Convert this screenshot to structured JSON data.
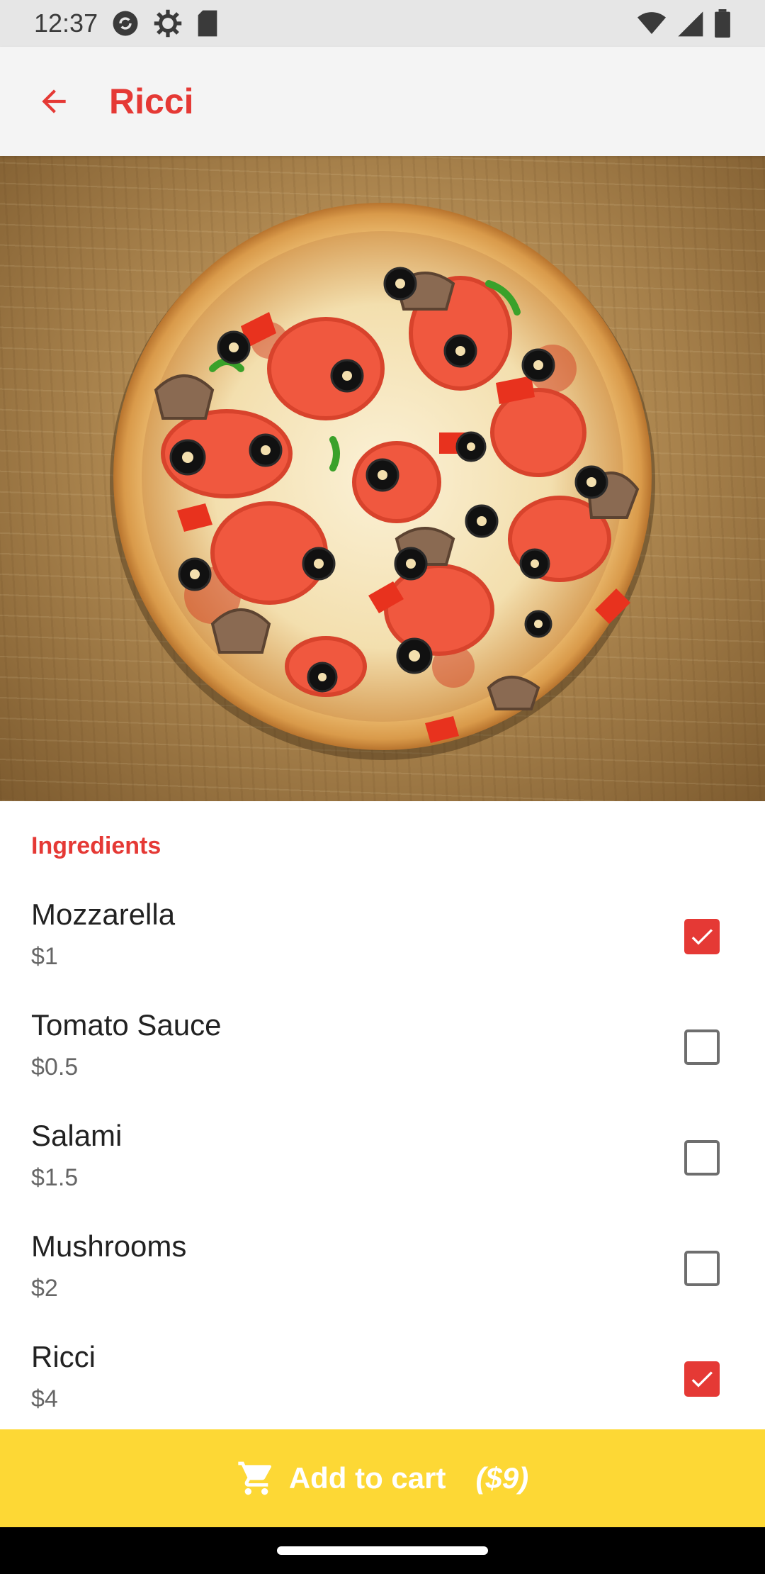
{
  "status_bar": {
    "time": "12:37"
  },
  "app_bar": {
    "title": "Ricci",
    "back_icon": "arrow-back-icon"
  },
  "colors": {
    "accent": "#e53935",
    "cart_bar": "#fdd835",
    "app_bar_bg": "#f4f4f4"
  },
  "ingredients": {
    "section_label": "Ingredients",
    "items": [
      {
        "name": "Mozzarella",
        "price": "$1",
        "checked": true
      },
      {
        "name": "Tomato Sauce",
        "price": "$0.5",
        "checked": false
      },
      {
        "name": "Salami",
        "price": "$1.5",
        "checked": false
      },
      {
        "name": "Mushrooms",
        "price": "$2",
        "checked": false
      },
      {
        "name": "Ricci",
        "price": "$4",
        "checked": true
      }
    ]
  },
  "cart": {
    "label": "Add to cart",
    "total": "($9)",
    "icon": "shopping-cart-icon"
  }
}
